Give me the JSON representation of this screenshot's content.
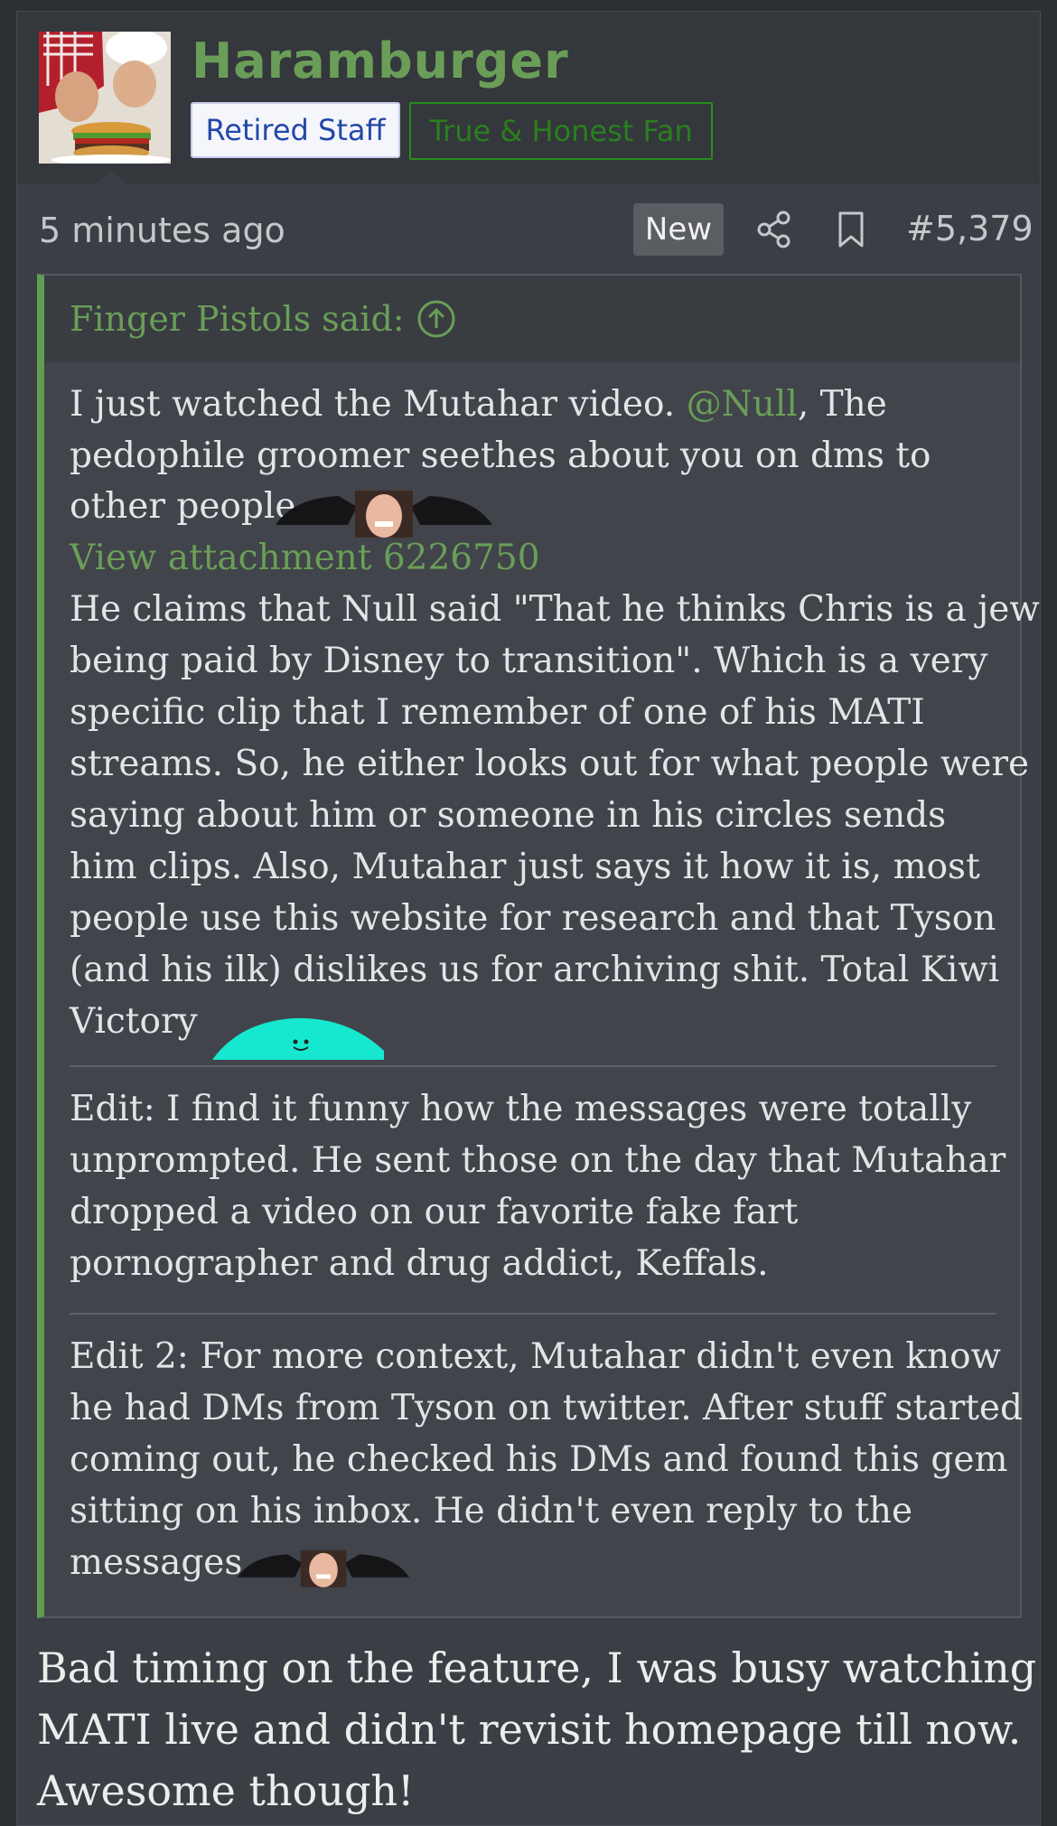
{
  "user": {
    "username": "Haramburger",
    "badges": [
      "Retired Staff",
      "True & Honest Fan"
    ]
  },
  "meta": {
    "time": "5 minutes ago",
    "new_label": "New",
    "post_number": "#5,379"
  },
  "quote": {
    "author": "Finger Pistols said:",
    "p1": {
      "l1_a": "I just watched the Mutahar video. ",
      "mention": "@Null",
      "l1_b": ", The",
      "l2": "pedophile groomer seethes about you on dms to",
      "l3": "other people"
    },
    "attachment": "View attachment 6226750",
    "p2": [
      "He claims that Null said \"That he thinks Chris is a jew",
      "being paid by Disney to transition\". Which is a very",
      "specific clip that I remember of one of his MATI",
      "streams. So, he either looks out for what people were",
      "saying about him or someone in his circles sends",
      "him clips. Also, Mutahar just says it how it is, most",
      "people use this website for research and that Tyson",
      "(and his ilk) dislikes us for archiving shit. Total Kiwi",
      "Victory"
    ],
    "edit1": [
      "Edit: I find it funny how the messages were totally",
      "unprompted. He sent those on the day that Mutahar",
      "dropped a video on our favorite fake fart",
      "pornographer and drug addict, Keffals."
    ],
    "edit2": [
      "Edit 2: For more context, Mutahar didn't even know",
      "he had DMs from Tyson on twitter. After stuff started",
      "coming out, he checked his DMs and found this gem",
      "sitting on his inbox. He didn't even reply to the",
      "messages."
    ]
  },
  "reply": [
    "Bad timing on the feature, I was busy watching",
    "MATI live and didn't revisit homepage till now.",
    "Awesome though!"
  ],
  "colors": {
    "username": "#6a9e58",
    "link": "#6a9e58",
    "quote_bar": "#5f9e52",
    "background": "#3b3e44"
  }
}
